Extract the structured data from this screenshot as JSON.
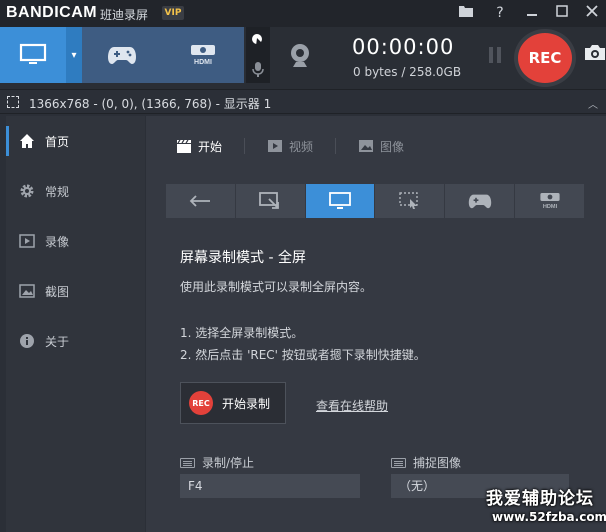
{
  "titlebar": {
    "logo": "BANDICAM",
    "app_name": "班迪录屏",
    "vip": "VIP",
    "help_icon": "?"
  },
  "toolbar": {
    "timer": "00:00:00",
    "size": "0 bytes / 258.0GB",
    "rec_label": "REC"
  },
  "status": {
    "text": "1366x768 - (0, 0), (1366, 768) - 显示器 1"
  },
  "sidebar": {
    "items": [
      {
        "label": "首页",
        "icon": "home-icon"
      },
      {
        "label": "常规",
        "icon": "gear-icon"
      },
      {
        "label": "录像",
        "icon": "video-icon"
      },
      {
        "label": "截图",
        "icon": "image-icon"
      },
      {
        "label": "关于",
        "icon": "info-icon"
      }
    ]
  },
  "main": {
    "tabs": [
      {
        "label": "开始"
      },
      {
        "label": "视频"
      },
      {
        "label": "图像"
      }
    ],
    "heading": "屏幕录制模式 - 全屏",
    "description": "使用此录制模式可以录制全屏内容。",
    "step1": "1. 选择全屏录制模式。",
    "step2": "2. 然后点击 'REC' 按钮或者摁下录制快捷键。",
    "start_button": "开始录制",
    "rec_dot": "REC",
    "help_link": "查看在线帮助",
    "hotkeys": [
      {
        "label": "录制/停止",
        "value": "F4"
      },
      {
        "label": "捕捉图像",
        "value": "（无）"
      }
    ]
  },
  "watermark": {
    "line1": "我爱辅助论坛",
    "line2": "www.52fzba.com"
  },
  "colors": {
    "accent": "#3c8fd8",
    "rec": "#e3413a",
    "mode_inactive": "#3e5c82"
  }
}
